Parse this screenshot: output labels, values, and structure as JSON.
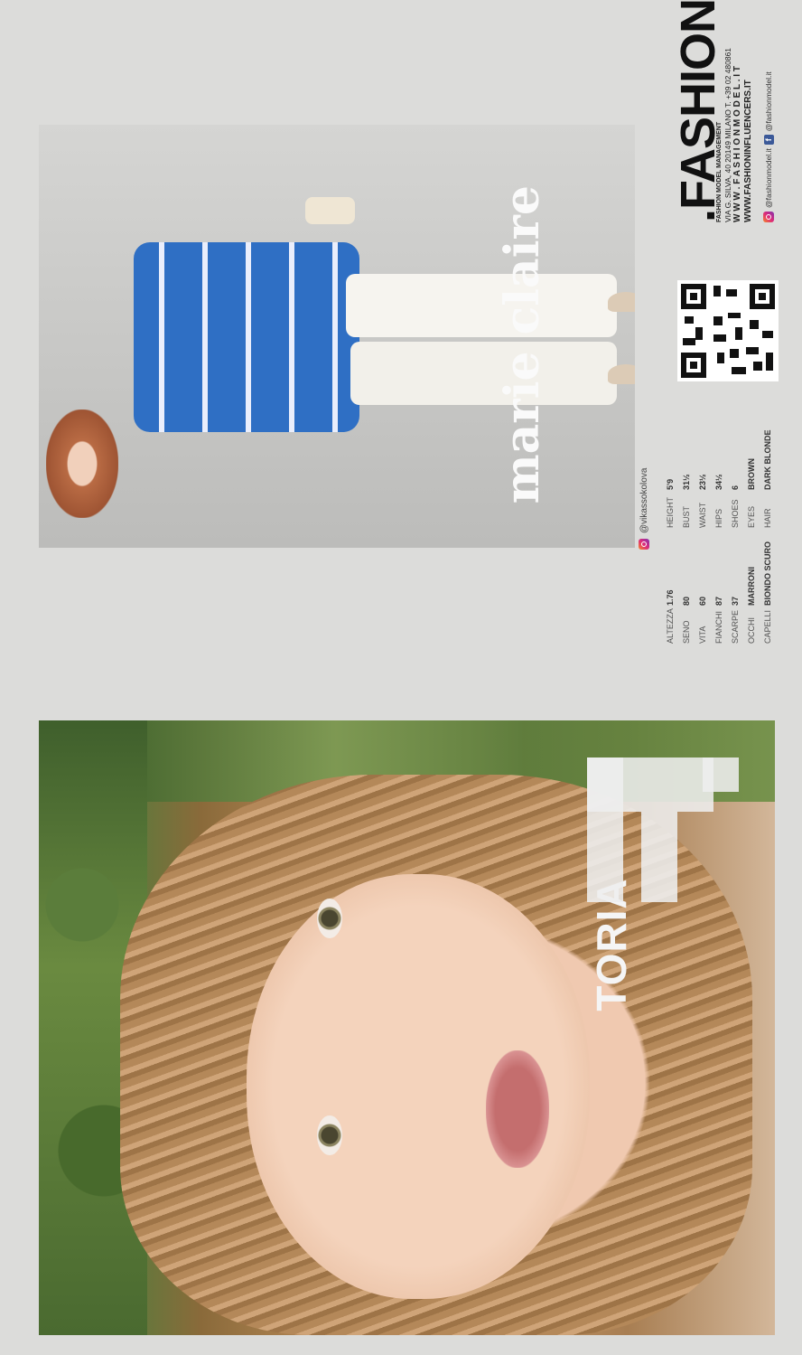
{
  "model": {
    "name": "TORIA",
    "instagram": "@vikassokolova"
  },
  "magazine": "marie claire",
  "measurements": {
    "it": [
      {
        "label": "ALTEZZA",
        "value": "1.76"
      },
      {
        "label": "SENO",
        "value": "80"
      },
      {
        "label": "VITA",
        "value": "60"
      },
      {
        "label": "FIANCHI",
        "value": "87"
      },
      {
        "label": "SCARPE",
        "value": "37"
      },
      {
        "label": "OCCHI",
        "value": "MARRONI"
      },
      {
        "label": "CAPELLI",
        "value": "BIONDO SCURO"
      }
    ],
    "en": [
      {
        "label": "HEIGHT",
        "value": "5'9"
      },
      {
        "label": "BUST",
        "value": "31½"
      },
      {
        "label": "WAIST",
        "value": "23½"
      },
      {
        "label": "HIPS",
        "value": "34½"
      },
      {
        "label": "SHOES",
        "value": "6"
      },
      {
        "label": "EYES",
        "value": "BROWN"
      },
      {
        "label": "HAIR",
        "value": "DARK BLONDE"
      }
    ]
  },
  "agency": {
    "logo": ".FASHION",
    "tagline": "FASHION MODEL MANAGEMENT",
    "address": "VIA G. SILVA, 40  20149 MILANO  T. +39 02 480861",
    "website1": "W W W . F A S H I O N M O D E L . I T",
    "website2": "WWW.FASHIONINFLUENCERS.IT",
    "instagram": "@fashionmodel.it",
    "facebook": "@fashionmodel.it"
  },
  "colors": {
    "background": "#dcdcda",
    "cardigan": "#2f6fc4",
    "text_dark": "#111111"
  }
}
